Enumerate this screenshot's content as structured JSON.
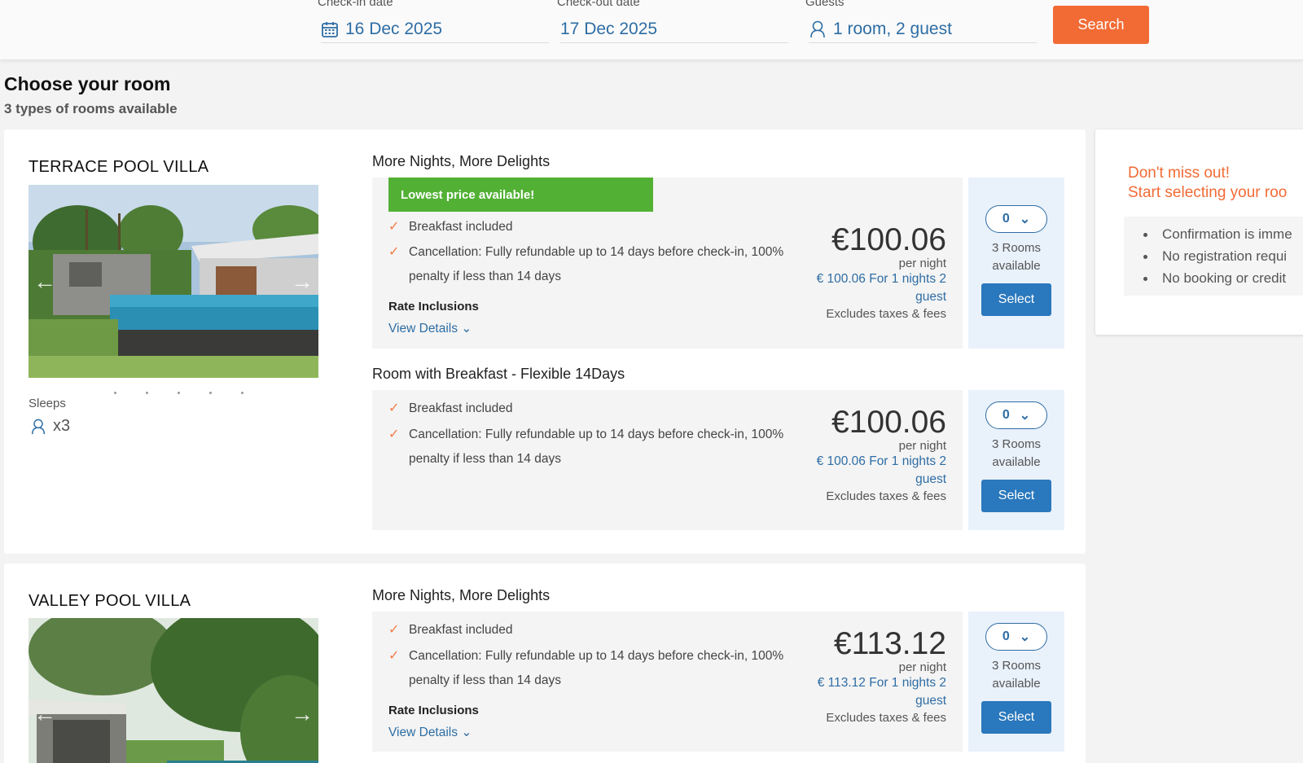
{
  "search": {
    "checkin_label": "Check-in date",
    "checkin_value": "16 Dec 2025",
    "checkout_label": "Check-out date",
    "checkout_value": "17 Dec 2025",
    "guests_label": "Guests",
    "guests_value": "1 room, 2 guest",
    "button": "Search"
  },
  "page": {
    "title": "Choose your room",
    "subtitle": "3 types of rooms available"
  },
  "rooms": [
    {
      "name": "TERRACE POOL VILLA",
      "sleeps_label": "Sleeps",
      "sleeps_value": "x3",
      "rates": [
        {
          "title": "More Nights, More Delights",
          "badge": "Lowest price available!",
          "features": [
            "Breakfast included",
            "Cancellation: Fully refundable up to 14 days before check-in, 100% penalty if less than 14 days"
          ],
          "inclusions_label": "Rate Inclusions",
          "view_details": "View Details",
          "price": "€100.06",
          "per_night": "per night",
          "price_for": "€ 100.06 For 1 nights 2 guest",
          "excludes": "Excludes taxes & fees",
          "qty": "0",
          "availability": "3 Rooms available",
          "select": "Select"
        },
        {
          "title": "Room with Breakfast - Flexible 14Days",
          "features": [
            "Breakfast included",
            "Cancellation: Fully refundable up to 14 days before check-in, 100% penalty if less than 14 days"
          ],
          "price": "€100.06",
          "per_night": "per night",
          "price_for": "€ 100.06 For 1 nights 2 guest",
          "excludes": "Excludes taxes & fees",
          "qty": "0",
          "availability": "3 Rooms available",
          "select": "Select"
        }
      ]
    },
    {
      "name": "VALLEY POOL VILLA",
      "rates": [
        {
          "title": "More Nights, More Delights",
          "features": [
            "Breakfast included",
            "Cancellation: Fully refundable up to 14 days before check-in, 100% penalty if less than 14 days"
          ],
          "inclusions_label": "Rate Inclusions",
          "view_details": "View Details",
          "price": "€113.12",
          "per_night": "per night",
          "price_for": "€ 113.12 For 1 nights 2 guest",
          "excludes": "Excludes taxes & fees",
          "qty": "0",
          "availability": "3 Rooms available",
          "select": "Select"
        }
      ]
    }
  ],
  "side": {
    "heading_1": "Don't miss out!",
    "heading_2": "Start selecting your roo",
    "items": [
      "Confirmation is imme",
      "No registration requi",
      "No booking or credit"
    ]
  },
  "colors": {
    "accent": "#f26b35",
    "link": "#2e6da4",
    "badge": "#52b135",
    "select_button": "#2a78bd"
  }
}
